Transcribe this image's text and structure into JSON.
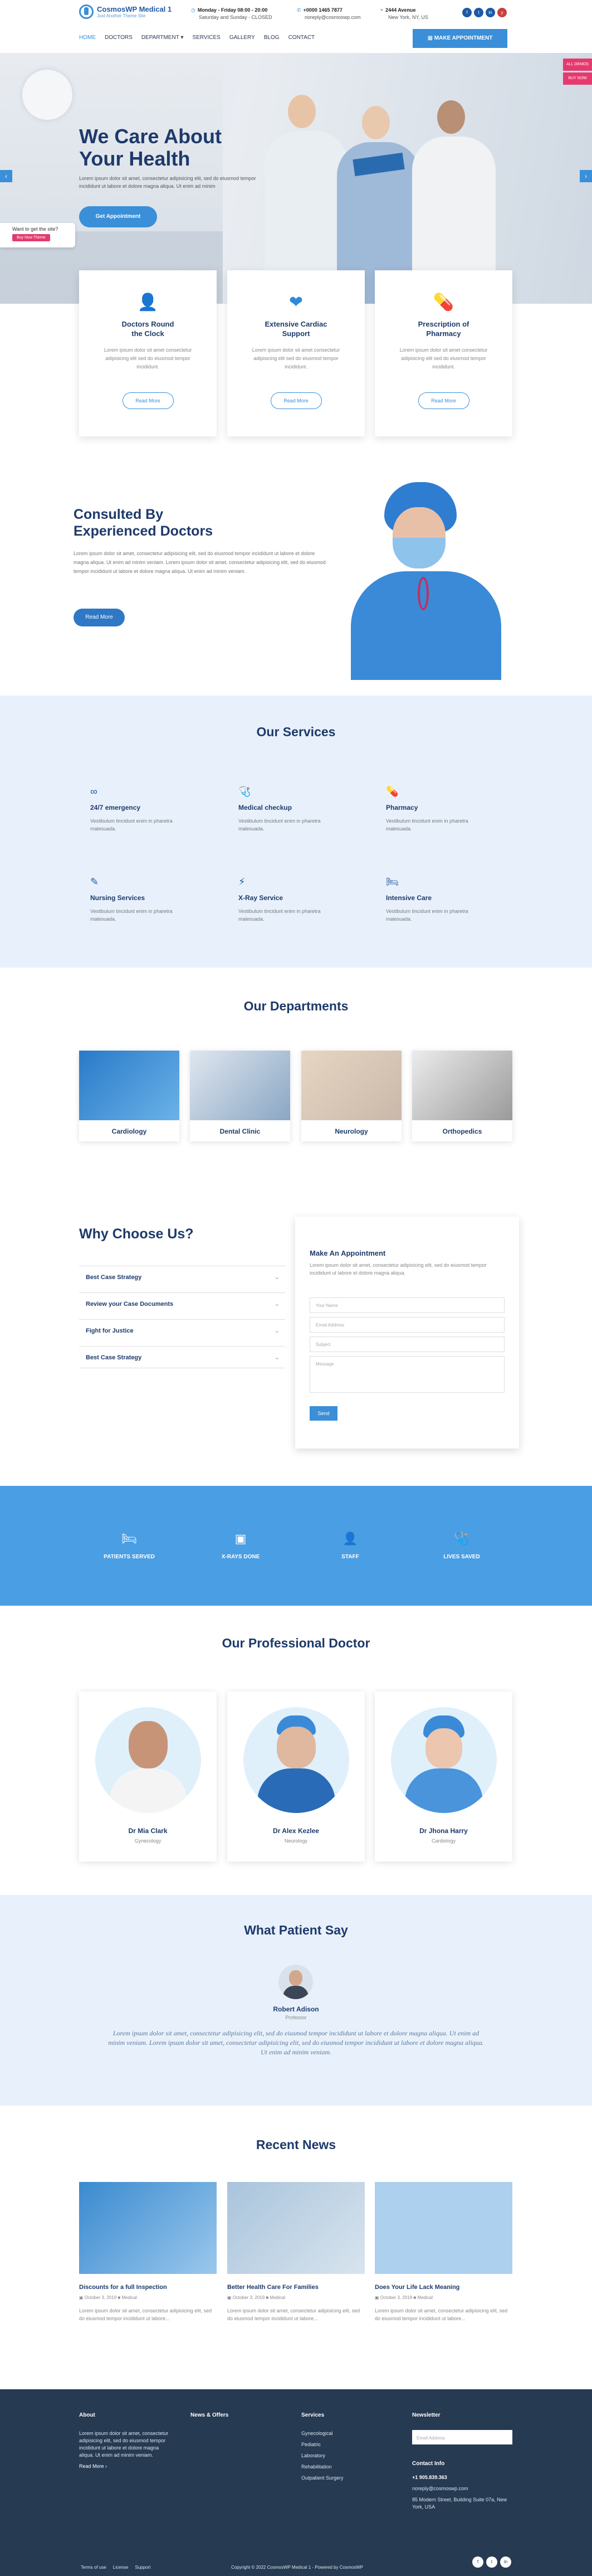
{
  "header": {
    "logo_title": "CosmosWP Medical 1",
    "logo_sub": "Just Another Theme Site",
    "hours_title": "Monday - Friday 08:00 - 20:00",
    "hours_sub": "Saturday and Sunday - CLOSED",
    "phone_title": "+0000 1465 7877",
    "phone_sub": "noreply@cosmoswp.com",
    "addr_title": "2444 Avenue",
    "addr_sub": "New York, NY, US",
    "appointment_btn": "MAKE APPOINTMENT",
    "nav": [
      "HOME",
      "DOCTORS",
      "DEPARTMENT ▾",
      "SERVICES",
      "GALLERY",
      "BLOG",
      "CONTACT"
    ],
    "social": [
      "f",
      "t",
      "in",
      "y"
    ]
  },
  "hero": {
    "title_1": "We Care About",
    "title_2": "Your Health",
    "text": "Lorem ipsum dolor sit amet, consectetur adipisicing elit, sed do eiusmod tempor incididunt ut labore et dolore magna aliqua. Ut enim ad minim",
    "button": "Get Appointment",
    "chat_q": "Want to get the site?",
    "chat_btn": "Buy Now Theme",
    "side_tabs": [
      "ALL DEMOS",
      "BUY NOW"
    ]
  },
  "features": [
    {
      "icon": "👤",
      "title_1": "Doctors Round",
      "title_2": "the Clock",
      "text": "Lorem ipsum dolor sit amet consectetur adipisicing elit sed do eiusmod tempor incididunt.",
      "button": "Read More"
    },
    {
      "icon": "❤",
      "title_1": "Extensive Cardiac",
      "title_2": "Support",
      "text": "Lorem ipsum dolor sit amet consectetur adipisicing elit sed do eiusmod tempor incididunt.",
      "button": "Read More"
    },
    {
      "icon": "💊",
      "title_1": "Prescription of",
      "title_2": "Pharmacy",
      "text": "Lorem ipsum dolor sit amet consectetur adipisicing elit sed do eiusmod tempor incididunt.",
      "button": "Read More"
    }
  ],
  "consult": {
    "title_1": "Consulted By",
    "title_2": "Experienced Doctors",
    "text": "Lorem ipsum dolor sit amet, consectetur adipisicing elit, sed do eiusmod tempor incididunt ut labore et dolore magna aliqua. Ut enim ad minim veniam. Lorem ipsum dolor sit amet, consectetur adipisicing elit, sed do eiusmod tempor incididunt ut labore et dolore magna aliqua. Ut enim ad minim veniam.",
    "button": "Read More"
  },
  "services": {
    "title": "Our Services",
    "items": [
      {
        "icon": "∞",
        "title": "24/7 emergency",
        "text": "Vestibulum tincidunt enim in pharetra malesuada."
      },
      {
        "icon": "🩺",
        "title": "Medical checkup",
        "text": "Vestibulum tincidunt enim in pharetra malesuada."
      },
      {
        "icon": "💊",
        "title": "Pharmacy",
        "text": "Vestibulum tincidunt enim in pharetra malesuada."
      },
      {
        "icon": "✎",
        "title": "Nursing Services",
        "text": "Vestibulum tincidunt enim in pharetra malesuada."
      },
      {
        "icon": "⚡",
        "title": "X-Ray Service",
        "text": "Vestibulum tincidunt enim in pharetra malesuada."
      },
      {
        "icon": "🛏",
        "title": "Intensive Care",
        "text": "Vestibulum tincidunt enim in pharetra malesuada."
      }
    ]
  },
  "departments": {
    "title": "Our Departments",
    "items": [
      "Cardiology",
      "Dental Clinic",
      "Neurology",
      "Orthopedics"
    ]
  },
  "why": {
    "title": "Why Choose Us?",
    "items": [
      "Best Case Strategy",
      "Review your Case Documents",
      "Fight for Justice",
      "Best Case Strategy"
    ]
  },
  "form": {
    "title": "Make An Appointment",
    "text": "Lorem ipsum dolor sit amet, consectetur adipisicing elit, sed do eiusmod tempor incididunt ut labore et dolore magna aliqua.",
    "name": "Your Name",
    "email": "Email Address",
    "subject": "Subject",
    "message": "Message",
    "submit": "Send"
  },
  "stats": [
    "PATIENTS SERVED",
    "X-RAYS DONE",
    "STAFF",
    "LIVES SAVED"
  ],
  "doctors": {
    "title": "Our Professional Doctor",
    "items": [
      {
        "name": "Dr Mia Clark",
        "role": "Gynecology"
      },
      {
        "name": "Dr Alex Kezlee",
        "role": "Neurology"
      },
      {
        "name": "Dr Jhona Harry",
        "role": "Cardiology"
      }
    ]
  },
  "testimonial": {
    "title": "What Patient Say",
    "name": "Robert Adison",
    "role": "Professor",
    "text": "Lorem ipsum dolor sit amet, consectetur adipisicing elit, sed do eiusmod tempor incididunt ut labore et dolore magna aliqua. Ut enim ad minim veniam. Lorem ipsum dolor sit amet, consectetur adipisicing elit, sed do eiusmod tempor incididunt ut labore et dolore magna aliqua. Ut enim ad minim veniam."
  },
  "news": {
    "title": "Recent News",
    "items": [
      {
        "title": "Discounts for a full Inspection",
        "meta": "October 3, 2019  ■ Medical",
        "text": "Lorem ipsum dolor sit amet, consectetur adipisicing elit, sed do eiusmod tempor incididunt ut labore..."
      },
      {
        "title": "Better Health Care For Families",
        "meta": "October 3, 2019  ■ Medical",
        "text": "Lorem ipsum dolor sit amet, consectetur adipisicing elit, sed do eiusmod tempor incididunt ut labore..."
      },
      {
        "title": "Does Your Life Lack Meaning",
        "meta": "October 3, 2019  ■ Medical",
        "text": "Lorem ipsum dolor sit amet, consectetur adipisicing elit, sed do eiusmod tempor incididunt ut labore..."
      }
    ]
  },
  "footer": {
    "about_title": "About",
    "about_text": "Lorem ipsum dolor sit amet, consectetur adipisicing elit, sed do eiusmod tempor incididunt ut labore et dolore magna aliqua. Ut enim ad minim veniam.",
    "about_more": "Read More ›",
    "news_title": "News & Offers",
    "services_title": "Services",
    "services": [
      "Gynecological",
      "Pediatric",
      "Laboratory",
      "Rehabilitation",
      "Outpatient Surgery"
    ],
    "newsletter_title": "Newsletter",
    "newsletter_ph": "Email Address",
    "contact_title": "Contact Info",
    "phone": "+1 905.839.363",
    "email": "noreply@cosmoswp.com",
    "address": "85 Modern Street, Building Suite 07a, New York, USA",
    "bottom_links": [
      "Terms of use",
      "License",
      "Support"
    ],
    "copyright": "Copyright © 2022 CosmosWP Medical 1 - Powered by CosmosWP",
    "social": [
      "f",
      "t",
      "in"
    ]
  }
}
